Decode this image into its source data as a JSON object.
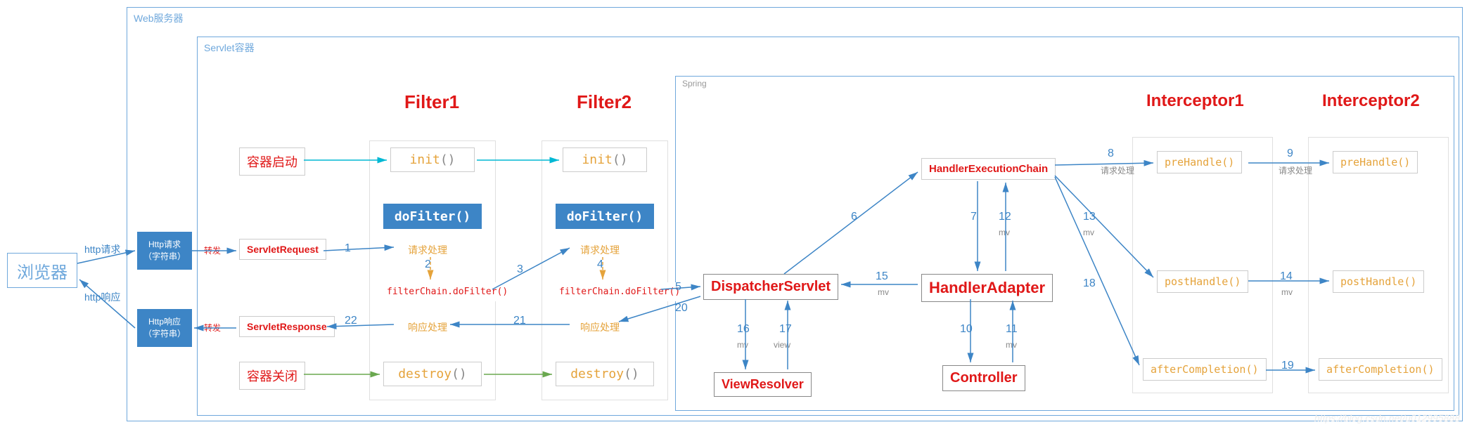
{
  "containers": {
    "web_server": "Web服务器",
    "servlet_container": "Servlet容器",
    "spring": "Spring"
  },
  "browser": "浏览器",
  "http_req_label": "http请求",
  "http_resp_label": "http响应",
  "http_req_box_l1": "Http请求",
  "http_req_box_l2": "（字符串）",
  "http_resp_box_l1": "Http响应",
  "http_resp_box_l2": "（字符串）",
  "forward": "转发",
  "servlet_request": "ServletRequest",
  "servlet_response": "ServletResponse",
  "container_start": "容器启动",
  "container_close": "容器关闭",
  "filter1_title": "Filter1",
  "filter2_title": "Filter2",
  "init": "init",
  "paren": "()",
  "dofilter": "doFilter()",
  "request_proc": "请求处理",
  "response_proc": "响应处理",
  "filterchain_do": "filterChain.doFilter()",
  "destroy": "destroy",
  "dispatcher": "DispatcherServlet",
  "hec": "HandlerExecutionChain",
  "handler_adapter": "HandlerAdapter",
  "controller": "Controller",
  "view_resolver": "ViewResolver",
  "interceptor1_title": "Interceptor1",
  "interceptor2_title": "Interceptor2",
  "prehandle": "preHandle",
  "posthandle": "postHandle",
  "aftercompletion": "afterCompletion",
  "steps": {
    "s1": "1",
    "s2": "2",
    "s3": "3",
    "s4": "4",
    "s5": "5",
    "s6": "6",
    "s7": "7",
    "s8": "8",
    "s9": "9",
    "s10": "10",
    "s11": "11",
    "s12": "12",
    "s13": "13",
    "s14": "14",
    "s15": "15",
    "s16": "16",
    "s17": "17",
    "s18": "18",
    "s19": "19",
    "s20": "20",
    "s21": "21",
    "s22": "22"
  },
  "mv": "mv",
  "view": "view",
  "req_proc_small": "请求处理",
  "watermark": "https://blog.csdn.net/u012995888"
}
